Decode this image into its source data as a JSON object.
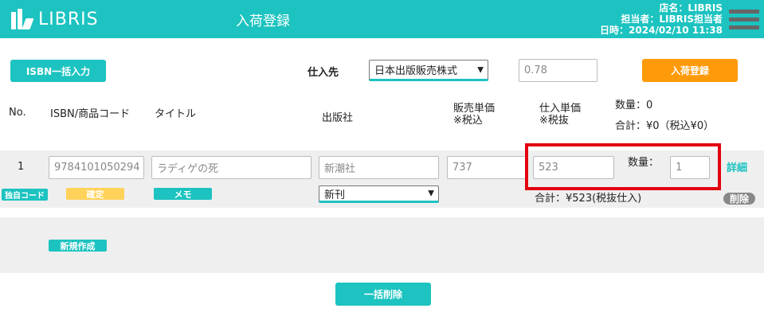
{
  "header": {
    "logo_text": "LIBRIS",
    "title": "入荷登録",
    "store": "店名：LIBRIS",
    "staff": "担当者：LIBRIS担当者",
    "datetime": "日時：2024/02/10 11:38"
  },
  "toolbar": {
    "isbn_bulk_button": "ISBN一括入力",
    "supplier_label": "仕入先",
    "supplier_value": "日本出版販売株式",
    "rate_value": "0.78",
    "register_button": "入荷登録"
  },
  "columns": {
    "no": "No.",
    "isbn": "ISBN/商品コード",
    "title": "タイトル",
    "publisher": "出版社",
    "sale_price_1": "販売単価",
    "sale_price_2": "※税込",
    "cost_price_1": "仕入単価",
    "cost_price_2": "※税抜",
    "qty_total": "数量：0",
    "sum_total": "合計：¥0（税込¥0）"
  },
  "row": {
    "no": "1",
    "isbn": "9784101050294",
    "title": "ラディゲの死",
    "publisher": "新潮社",
    "sale_price": "737",
    "cost_price": "523",
    "qty_label": "数量：",
    "qty": "1",
    "detail_link": "詳細",
    "own_code_tag": "独自コード",
    "confirm_tag": "確定",
    "memo_tag": "メモ",
    "condition": "新刊",
    "subtotal": "合計：¥523(税抜仕入)",
    "delete_tag": "削除"
  },
  "footer": {
    "new_button": "新規作成",
    "bulk_delete_button": "一括削除"
  },
  "colors": {
    "accent": "#1cc3c0",
    "orange": "#ff9a0a",
    "highlight": "#e3000f"
  }
}
